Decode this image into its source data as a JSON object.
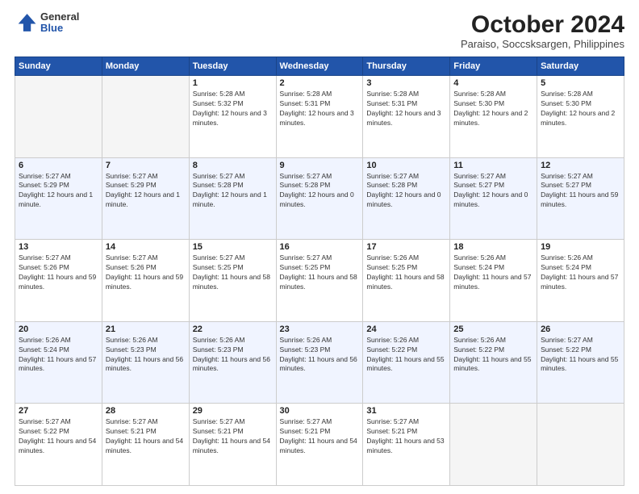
{
  "logo": {
    "general": "General",
    "blue": "Blue"
  },
  "header": {
    "month": "October 2024",
    "location": "Paraiso, Soccsksargen, Philippines"
  },
  "weekdays": [
    "Sunday",
    "Monday",
    "Tuesday",
    "Wednesday",
    "Thursday",
    "Friday",
    "Saturday"
  ],
  "weeks": [
    [
      {
        "day": "",
        "info": ""
      },
      {
        "day": "",
        "info": ""
      },
      {
        "day": "1",
        "info": "Sunrise: 5:28 AM\nSunset: 5:32 PM\nDaylight: 12 hours and 3 minutes."
      },
      {
        "day": "2",
        "info": "Sunrise: 5:28 AM\nSunset: 5:31 PM\nDaylight: 12 hours and 3 minutes."
      },
      {
        "day": "3",
        "info": "Sunrise: 5:28 AM\nSunset: 5:31 PM\nDaylight: 12 hours and 3 minutes."
      },
      {
        "day": "4",
        "info": "Sunrise: 5:28 AM\nSunset: 5:30 PM\nDaylight: 12 hours and 2 minutes."
      },
      {
        "day": "5",
        "info": "Sunrise: 5:28 AM\nSunset: 5:30 PM\nDaylight: 12 hours and 2 minutes."
      }
    ],
    [
      {
        "day": "6",
        "info": "Sunrise: 5:27 AM\nSunset: 5:29 PM\nDaylight: 12 hours and 1 minute."
      },
      {
        "day": "7",
        "info": "Sunrise: 5:27 AM\nSunset: 5:29 PM\nDaylight: 12 hours and 1 minute."
      },
      {
        "day": "8",
        "info": "Sunrise: 5:27 AM\nSunset: 5:28 PM\nDaylight: 12 hours and 1 minute."
      },
      {
        "day": "9",
        "info": "Sunrise: 5:27 AM\nSunset: 5:28 PM\nDaylight: 12 hours and 0 minutes."
      },
      {
        "day": "10",
        "info": "Sunrise: 5:27 AM\nSunset: 5:28 PM\nDaylight: 12 hours and 0 minutes."
      },
      {
        "day": "11",
        "info": "Sunrise: 5:27 AM\nSunset: 5:27 PM\nDaylight: 12 hours and 0 minutes."
      },
      {
        "day": "12",
        "info": "Sunrise: 5:27 AM\nSunset: 5:27 PM\nDaylight: 11 hours and 59 minutes."
      }
    ],
    [
      {
        "day": "13",
        "info": "Sunrise: 5:27 AM\nSunset: 5:26 PM\nDaylight: 11 hours and 59 minutes."
      },
      {
        "day": "14",
        "info": "Sunrise: 5:27 AM\nSunset: 5:26 PM\nDaylight: 11 hours and 59 minutes."
      },
      {
        "day": "15",
        "info": "Sunrise: 5:27 AM\nSunset: 5:25 PM\nDaylight: 11 hours and 58 minutes."
      },
      {
        "day": "16",
        "info": "Sunrise: 5:27 AM\nSunset: 5:25 PM\nDaylight: 11 hours and 58 minutes."
      },
      {
        "day": "17",
        "info": "Sunrise: 5:26 AM\nSunset: 5:25 PM\nDaylight: 11 hours and 58 minutes."
      },
      {
        "day": "18",
        "info": "Sunrise: 5:26 AM\nSunset: 5:24 PM\nDaylight: 11 hours and 57 minutes."
      },
      {
        "day": "19",
        "info": "Sunrise: 5:26 AM\nSunset: 5:24 PM\nDaylight: 11 hours and 57 minutes."
      }
    ],
    [
      {
        "day": "20",
        "info": "Sunrise: 5:26 AM\nSunset: 5:24 PM\nDaylight: 11 hours and 57 minutes."
      },
      {
        "day": "21",
        "info": "Sunrise: 5:26 AM\nSunset: 5:23 PM\nDaylight: 11 hours and 56 minutes."
      },
      {
        "day": "22",
        "info": "Sunrise: 5:26 AM\nSunset: 5:23 PM\nDaylight: 11 hours and 56 minutes."
      },
      {
        "day": "23",
        "info": "Sunrise: 5:26 AM\nSunset: 5:23 PM\nDaylight: 11 hours and 56 minutes."
      },
      {
        "day": "24",
        "info": "Sunrise: 5:26 AM\nSunset: 5:22 PM\nDaylight: 11 hours and 55 minutes."
      },
      {
        "day": "25",
        "info": "Sunrise: 5:26 AM\nSunset: 5:22 PM\nDaylight: 11 hours and 55 minutes."
      },
      {
        "day": "26",
        "info": "Sunrise: 5:27 AM\nSunset: 5:22 PM\nDaylight: 11 hours and 55 minutes."
      }
    ],
    [
      {
        "day": "27",
        "info": "Sunrise: 5:27 AM\nSunset: 5:22 PM\nDaylight: 11 hours and 54 minutes."
      },
      {
        "day": "28",
        "info": "Sunrise: 5:27 AM\nSunset: 5:21 PM\nDaylight: 11 hours and 54 minutes."
      },
      {
        "day": "29",
        "info": "Sunrise: 5:27 AM\nSunset: 5:21 PM\nDaylight: 11 hours and 54 minutes."
      },
      {
        "day": "30",
        "info": "Sunrise: 5:27 AM\nSunset: 5:21 PM\nDaylight: 11 hours and 54 minutes."
      },
      {
        "day": "31",
        "info": "Sunrise: 5:27 AM\nSunset: 5:21 PM\nDaylight: 11 hours and 53 minutes."
      },
      {
        "day": "",
        "info": ""
      },
      {
        "day": "",
        "info": ""
      }
    ]
  ]
}
